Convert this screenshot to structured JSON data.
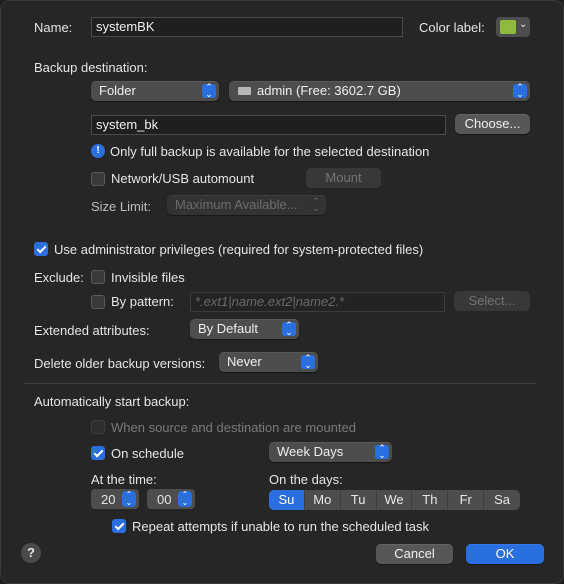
{
  "name": {
    "label": "Name:",
    "value": "systemBK"
  },
  "color_label": {
    "label": "Color label:",
    "color": "#8fba3c"
  },
  "backup_destination": {
    "heading": "Backup destination:",
    "type_value": "Folder",
    "disk_value": "admin (Free: 3602.7 GB)",
    "disk_icon": "hard-drive-icon",
    "folder_value": "system_bk",
    "choose_label": "Choose...",
    "info_text": "Only full backup is available for the selected destination",
    "automount_label": "Network/USB automount",
    "mount_label": "Mount",
    "size_limit_label": "Size Limit:",
    "size_limit_value": "Maximum Available..."
  },
  "admin_privileges": {
    "label": "Use administrator privileges (required for system-protected files)",
    "checked": true
  },
  "exclude": {
    "label": "Exclude:",
    "invisible_label": "Invisible files",
    "pattern_label": "By pattern:",
    "pattern_placeholder": "*.ext1|name.ext2|name2.*",
    "select_label": "Select..."
  },
  "extended_attributes": {
    "label": "Extended attributes:",
    "value": "By Default"
  },
  "delete_older": {
    "label": "Delete older backup versions:",
    "value": "Never"
  },
  "auto_start": {
    "heading": "Automatically start backup:",
    "when_mounted_label": "When source and destination are mounted",
    "on_schedule_label": "On schedule",
    "schedule_value": "Week Days",
    "at_time_label": "At the time:",
    "hour": "20",
    "minute": "00",
    "on_days_label": "On the days:",
    "days": [
      {
        "label": "Su",
        "on": true
      },
      {
        "label": "Mo",
        "on": false
      },
      {
        "label": "Tu",
        "on": false
      },
      {
        "label": "We",
        "on": false
      },
      {
        "label": "Th",
        "on": false
      },
      {
        "label": "Fr",
        "on": false
      },
      {
        "label": "Sa",
        "on": false
      }
    ],
    "repeat_label": "Repeat attempts if unable to run the scheduled task"
  },
  "footer": {
    "help_label": "?",
    "cancel_label": "Cancel",
    "ok_label": "OK"
  }
}
